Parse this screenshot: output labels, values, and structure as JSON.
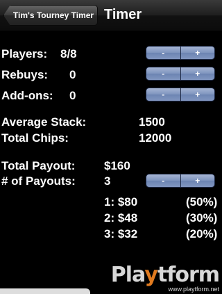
{
  "navbar": {
    "back_label": "Tim's Tourney Timer",
    "title": "Timer"
  },
  "rows": [
    {
      "label": "Players:",
      "value": "8/8"
    },
    {
      "label": "Rebuys:",
      "value": "0"
    },
    {
      "label": "Add-ons:",
      "value": "0"
    }
  ],
  "stepper": {
    "minus": "-",
    "plus": "+"
  },
  "stats": {
    "avg_stack_label": "Average Stack:",
    "avg_stack_value": "1500",
    "total_chips_label": "Total Chips:",
    "total_chips_value": "12000"
  },
  "payout": {
    "total_label": "Total Payout:",
    "total_value": "$160",
    "num_label": "# of Payouts:",
    "num_value": "3",
    "places": [
      {
        "place": "1: $80",
        "pct": "(50%)"
      },
      {
        "place": "2: $48",
        "pct": "(30%)"
      },
      {
        "place": "3: $32",
        "pct": "(20%)"
      }
    ]
  },
  "watermark": {
    "logo_pre": "Pla",
    "logo_y": "y",
    "logo_post": "tform",
    "url": "www.playtform.net"
  },
  "colors": {
    "button_blue": "#7d93bd",
    "logo_orange": "#e07a1f"
  }
}
